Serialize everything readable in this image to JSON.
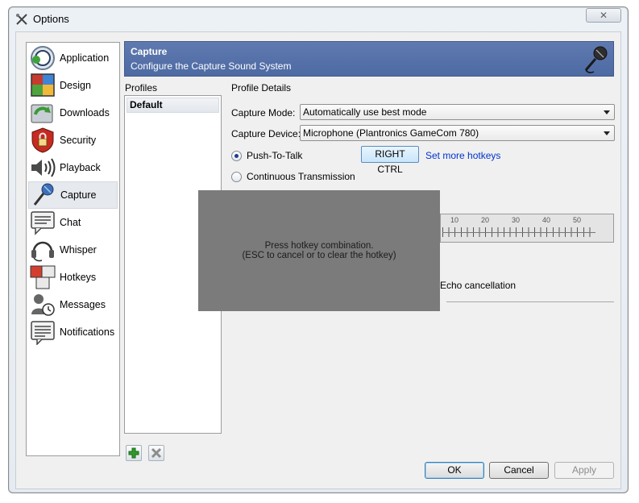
{
  "window": {
    "title": "Options",
    "close_symbol": "✕"
  },
  "sidebar": {
    "items": [
      {
        "label": "Application",
        "icon": "application-icon"
      },
      {
        "label": "Design",
        "icon": "design-icon"
      },
      {
        "label": "Downloads",
        "icon": "downloads-icon"
      },
      {
        "label": "Security",
        "icon": "security-lock-icon"
      },
      {
        "label": "Playback",
        "icon": "speaker-icon"
      },
      {
        "label": "Capture",
        "icon": "microphone-icon",
        "selected": true
      },
      {
        "label": "Chat",
        "icon": "chat-icon"
      },
      {
        "label": "Whisper",
        "icon": "headset-icon"
      },
      {
        "label": "Hotkeys",
        "icon": "hotkeys-icon"
      },
      {
        "label": "Messages",
        "icon": "messages-icon"
      },
      {
        "label": "Notifications",
        "icon": "notifications-icon"
      }
    ]
  },
  "banner": {
    "title": "Capture",
    "subtitle": "Configure the Capture Sound System"
  },
  "profiles": {
    "label": "Profiles",
    "items": [
      "Default"
    ]
  },
  "details": {
    "label": "Profile Details",
    "capture_mode_label": "Capture Mode:",
    "capture_mode_value": "Automatically use best mode",
    "capture_device_label": "Capture Device:",
    "capture_device_value": "Microphone (Plantronics GameCom 780)",
    "push_to_talk_label": "Push-To-Talk",
    "hotkey_value": "RIGHT CTRL",
    "set_more_hotkeys": "Set more hotkeys",
    "continuous_label": "Continuous Transmission",
    "echo_label": "Echo cancellation",
    "slider_ticks": [
      "10",
      "20",
      "30",
      "40",
      "50"
    ]
  },
  "hotkey_prompt": {
    "line1": "Press hotkey combination.",
    "line2": "(ESC to cancel or to clear the hotkey)"
  },
  "buttons": {
    "ok": "OK",
    "cancel": "Cancel",
    "apply": "Apply"
  },
  "colors": {
    "banner": "#5f7ab0",
    "link": "#0033cc",
    "overlay": "#7b7b7b"
  }
}
